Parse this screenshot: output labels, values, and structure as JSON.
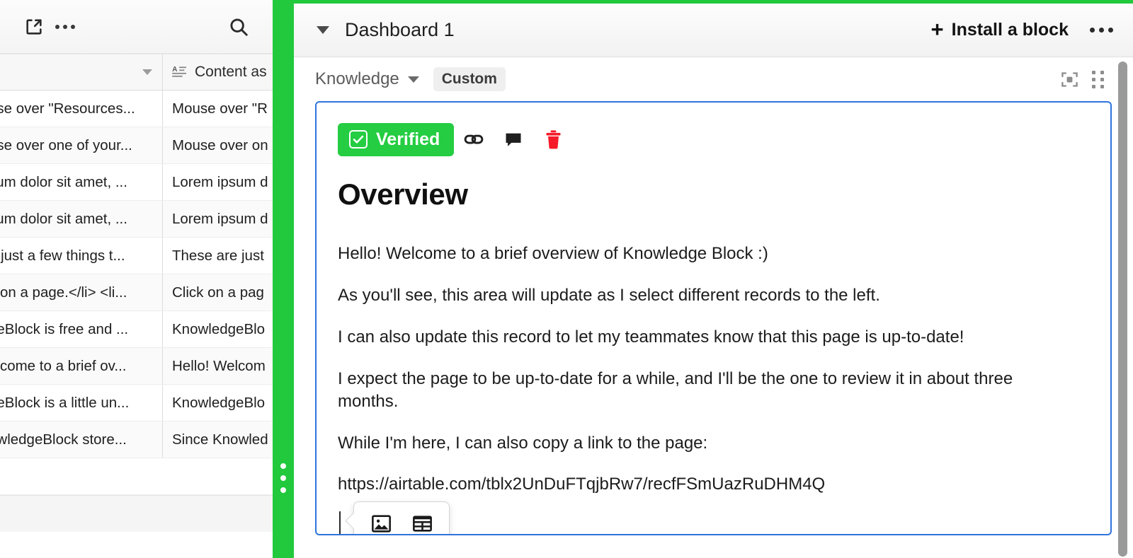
{
  "left_panel": {
    "toolbar": {
      "expand_icon": "expand-external-icon",
      "more_icon": "more-options-icon",
      "search_icon": "search-icon"
    },
    "grid": {
      "columns": [
        {
          "label": "",
          "icon": "sort-caret-icon"
        },
        {
          "label": "Content as",
          "icon": "long-text-field-icon"
        }
      ],
      "rows": [
        {
          "a": "use over \"Resources...",
          "b": "Mouse over \"R"
        },
        {
          "a": "use over one of your...",
          "b": "Mouse over on"
        },
        {
          "a": "sum dolor sit amet, ...",
          "b": "Lorem ipsum d"
        },
        {
          "a": "sum dolor sit amet, ...",
          "b": "Lorem ipsum d"
        },
        {
          "a": "e just a few things t...",
          "b": "These are just"
        },
        {
          "a": "k on a page.</li> <li...",
          "b": "Click on a pag"
        },
        {
          "a": "geBlock is free and ...",
          "b": "KnowledgeBlo"
        },
        {
          "a": "elcome to a brief ov...",
          "b": "Hello! Welcom"
        },
        {
          "a": "geBlock is a little un...",
          "b": "KnowledgeBlo"
        },
        {
          "a": "owledgeBlock store...",
          "b": "Since Knowled"
        }
      ]
    }
  },
  "divider": {
    "color": "#22c93d",
    "grip": "resize-grip-handle"
  },
  "right_panel": {
    "dashboard_bar": {
      "caret_icon": "chevron-down-icon",
      "title": "Dashboard 1",
      "install_label": "Install a block",
      "plus_icon": "plus-icon",
      "more_icon": "more-options-icon"
    },
    "block_toolbar": {
      "block_name": "Knowledge",
      "caret_icon": "chevron-down-icon",
      "chip_label": "Custom",
      "fullscreen_icon": "fullscreen-expand-icon",
      "drag_icon": "drag-grip-icon"
    },
    "record": {
      "status_badge": {
        "label": "Verified",
        "color": "#24cd41",
        "check_icon": "checkbox-checked-icon"
      },
      "actions": [
        {
          "name": "copy-link-icon"
        },
        {
          "name": "comment-icon"
        },
        {
          "name": "delete-trash-icon",
          "color": "#f51b28"
        }
      ],
      "title": "Overview",
      "paragraphs": [
        "Hello! Welcome to a brief overview of Knowledge Block :)",
        "As you'll see, this area will update as I select different records to the left.",
        "I can also update this record to let my teammates know that this page is up-to-date!",
        "I expect the page to be up-to-date for a while, and I'll be the one to review it in about three months.",
        "While I'm here, I can also copy a link to the page:"
      ],
      "url": "https://airtable.com/tblx2UnDuFTqjbRw7/recfFSmUazRuDHM4Q",
      "insert_toolbar": {
        "image_icon": "insert-image-icon",
        "table_icon": "insert-table-icon"
      }
    },
    "scrollbar": "vertical-scrollbar"
  }
}
